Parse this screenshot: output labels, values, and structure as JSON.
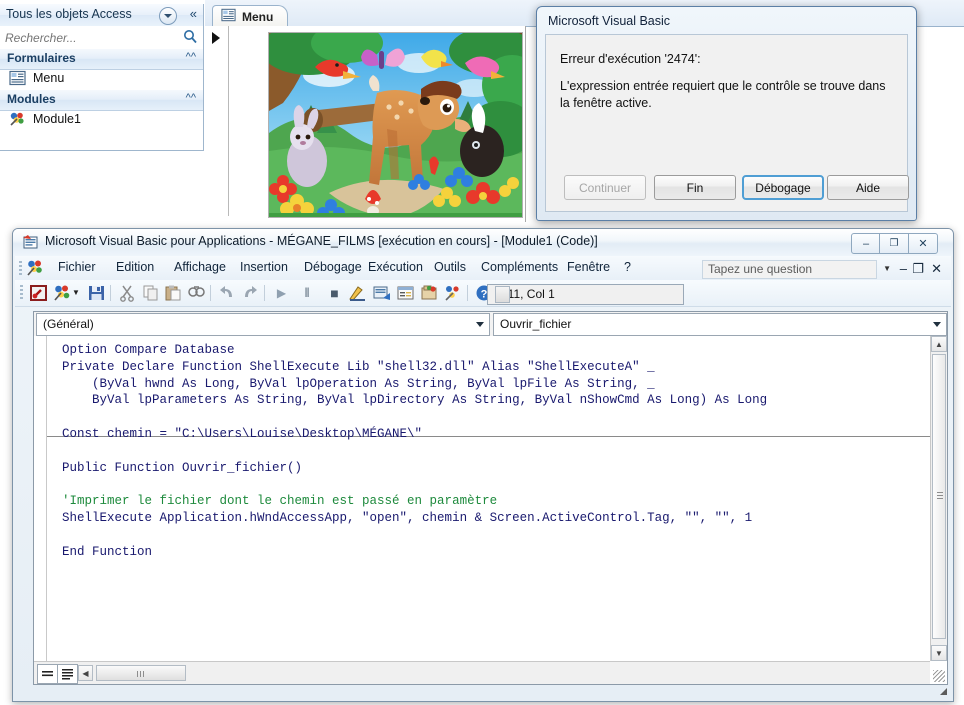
{
  "access": {
    "nav_pane": {
      "title": "Tous les objets Access",
      "dropdown_icon": "chevron-down-circle-icon",
      "collapse_icon": "double-chevron-left-icon",
      "search_placeholder": "Rechercher...",
      "search_value": "",
      "search_icon": "search-icon",
      "groups": [
        {
          "label": "Formulaires",
          "collapse_icon": "double-chevron-up-icon",
          "items": [
            {
              "label": "Menu",
              "icon": "form-icon"
            }
          ]
        },
        {
          "label": "Modules",
          "collapse_icon": "double-chevron-up-icon",
          "items": [
            {
              "label": "Module1",
              "icon": "module-icon"
            }
          ]
        }
      ]
    },
    "document_tab": {
      "label": "Menu",
      "icon": "form-icon"
    },
    "form": {
      "record_selector_icon": "right-triangle-icon",
      "image_alt": "bambi-illustration"
    }
  },
  "dialog": {
    "title": "Microsoft Visual Basic",
    "message_line1": "Erreur d'exécution '2474':",
    "message_line2": "L'expression entrée requiert que le contrôle se trouve dans la fenêtre active.",
    "buttons": [
      {
        "label": "Continuer",
        "state": "disabled"
      },
      {
        "label": "Fin",
        "state": "normal"
      },
      {
        "label": "Débogage",
        "state": "default"
      },
      {
        "label": "Aide",
        "state": "normal"
      }
    ]
  },
  "vbe": {
    "title": "Microsoft Visual Basic pour Applications - MÉGANE_FILMS [exécution en cours] - [Module1 (Code)]",
    "title_icon": "vba-app-icon",
    "window_buttons": [
      {
        "name": "minimize",
        "glyph": "–"
      },
      {
        "name": "restore",
        "glyph": "❐"
      },
      {
        "name": "close",
        "glyph": "✕"
      }
    ],
    "menus": [
      {
        "label": "Fichier",
        "accel": "F"
      },
      {
        "label": "Edition",
        "accel": "E"
      },
      {
        "label": "Affichage",
        "accel": "A"
      },
      {
        "label": "Insertion",
        "accel": "I"
      },
      {
        "label": "Débogage",
        "accel": "D"
      },
      {
        "label": "Exécution",
        "accel": "x"
      },
      {
        "label": "Outils",
        "accel": "O"
      },
      {
        "label": "Compléments",
        "accel": "C"
      },
      {
        "label": "Fenêtre",
        "accel": "n"
      },
      {
        "label": "?",
        "accel": ""
      }
    ],
    "question_box": {
      "placeholder": "Tapez une question",
      "value": ""
    },
    "mdi_buttons": [
      {
        "name": "mdi-minimize",
        "glyph": "–"
      },
      {
        "name": "mdi-restore",
        "glyph": "❐"
      },
      {
        "name": "mdi-close",
        "glyph": "✕"
      }
    ],
    "toolbar": [
      {
        "name": "view-access-icon",
        "glyph": ""
      },
      {
        "name": "insert-object-icon",
        "glyph": ""
      },
      {
        "name": "insert-dropdown-icon",
        "glyph": "▾"
      },
      {
        "name": "save-icon",
        "glyph": ""
      },
      {
        "name": "cut-icon",
        "glyph": ""
      },
      {
        "name": "copy-icon",
        "glyph": ""
      },
      {
        "name": "paste-icon",
        "glyph": ""
      },
      {
        "name": "find-icon",
        "glyph": ""
      },
      {
        "name": "undo-icon",
        "glyph": ""
      },
      {
        "name": "redo-icon",
        "glyph": ""
      },
      {
        "name": "run-icon",
        "glyph": "▶"
      },
      {
        "name": "pause-icon",
        "glyph": "‖"
      },
      {
        "name": "stop-icon",
        "glyph": "■"
      },
      {
        "name": "design-mode-icon",
        "glyph": ""
      },
      {
        "name": "project-explorer-icon",
        "glyph": ""
      },
      {
        "name": "properties-window-icon",
        "glyph": ""
      },
      {
        "name": "object-browser-icon",
        "glyph": ""
      },
      {
        "name": "toolbox-icon",
        "glyph": ""
      },
      {
        "name": "help-icon",
        "glyph": "?"
      }
    ],
    "position_box": {
      "value": "Li 11, Col 1"
    },
    "code_window": {
      "object_combo": {
        "value": "(Général)"
      },
      "procedure_combo": {
        "value": "Ouvrir_fichier"
      },
      "code_lines": [
        "Option Compare Database",
        "Private Declare Function ShellExecute Lib \"shell32.dll\" Alias \"ShellExecuteA\" _",
        "    (ByVal hwnd As Long, ByVal lpOperation As String, ByVal lpFile As String, _",
        "    ByVal lpParameters As String, ByVal lpDirectory As String, ByVal nShowCmd As Long) As Long",
        "",
        "Const chemin = \"C:\\Users\\Louise\\Desktop\\MÉGANE\\\"",
        "",
        "Public Function Ouvrir_fichier()",
        "",
        "'Imprimer le fichier dont le chemin est passé en paramètre",
        "ShellExecute Application.hWndAccessApp, \"open\", chemin & Screen.ActiveControl.Tag, \"\", \"\", 1",
        "",
        "End Function"
      ],
      "comment_line_index": 9,
      "view_buttons": [
        {
          "name": "procedure-view-icon"
        },
        {
          "name": "full-module-view-icon"
        }
      ]
    },
    "colors": {
      "code_text": "#19196e",
      "code_comment": "#1d8a3c",
      "dialog_accent": "#4f9ed4"
    }
  }
}
